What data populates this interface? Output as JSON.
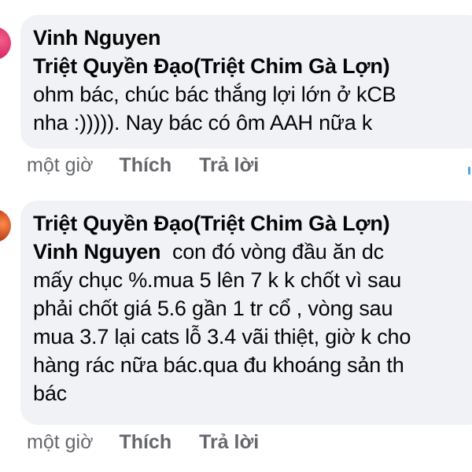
{
  "comments": [
    {
      "author": "Vinh Nguyen",
      "lines": [
        "Triệt Quyền Đạo(Triệt Chim Gà Lợn)",
        "ohm bác, chúc bác thắng lợi lớn ở kCB",
        "nha :))))). Nay bác có ôm AAH nữa k"
      ],
      "time": "một giờ",
      "like_label": "Thích",
      "reply_label": "Trả lời",
      "avatar_color": "#d81b60"
    },
    {
      "author": "Triệt Quyền Đạo(Triệt Chim Gà Lợn)",
      "mention": "Vinh Nguyen",
      "lines": [
        "con đó vòng đầu ăn dc",
        "mấy chục %.mua 5 lên 7 k k chốt vì sau",
        "phải chốt giá 5.6 gần 1 tr cổ , vòng sau",
        "mua 3.7 lại cats lỗ 3.4 vãi thiệt, giờ k cho",
        "hàng rác nữa bác.qua đu khoáng sản th",
        "bác"
      ],
      "time": "một giờ",
      "like_label": "Thích",
      "reply_label": "Trả lời",
      "avatar_color": "#c44a1e"
    }
  ],
  "colors": {
    "bubble_bg": "#f0f2f5",
    "text": "#050505",
    "meta": "#65676b",
    "accent": "#4aa8e8"
  }
}
